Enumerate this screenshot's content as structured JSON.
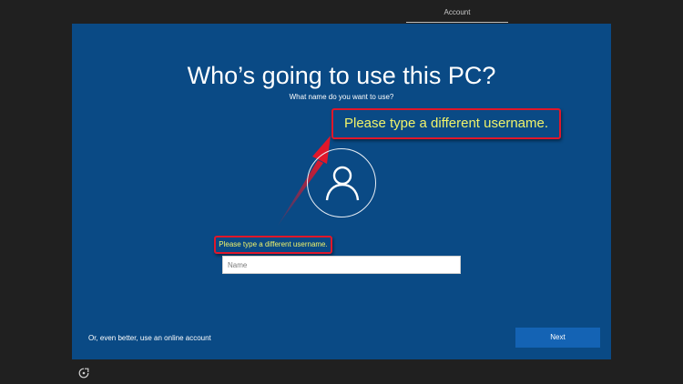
{
  "header": {
    "tab_label": "Account"
  },
  "main": {
    "title": "Who’s going to use this PC?",
    "subtitle": "What name do you want to use?",
    "callout_large_text": "Please type a different username.",
    "error_message": "Please type a different username.",
    "name_input": {
      "placeholder": "Name",
      "value": ""
    },
    "online_account_link": "Or, even better, use an online account",
    "next_label": "Next"
  },
  "icons": {
    "avatar": "user-icon",
    "ease_of_access": "ease-of-access-icon"
  },
  "colors": {
    "panel_background": "#0a4a85",
    "next_button": "#1463b4",
    "callout_border": "#e0172a",
    "callout_text": "#f0f36a"
  }
}
